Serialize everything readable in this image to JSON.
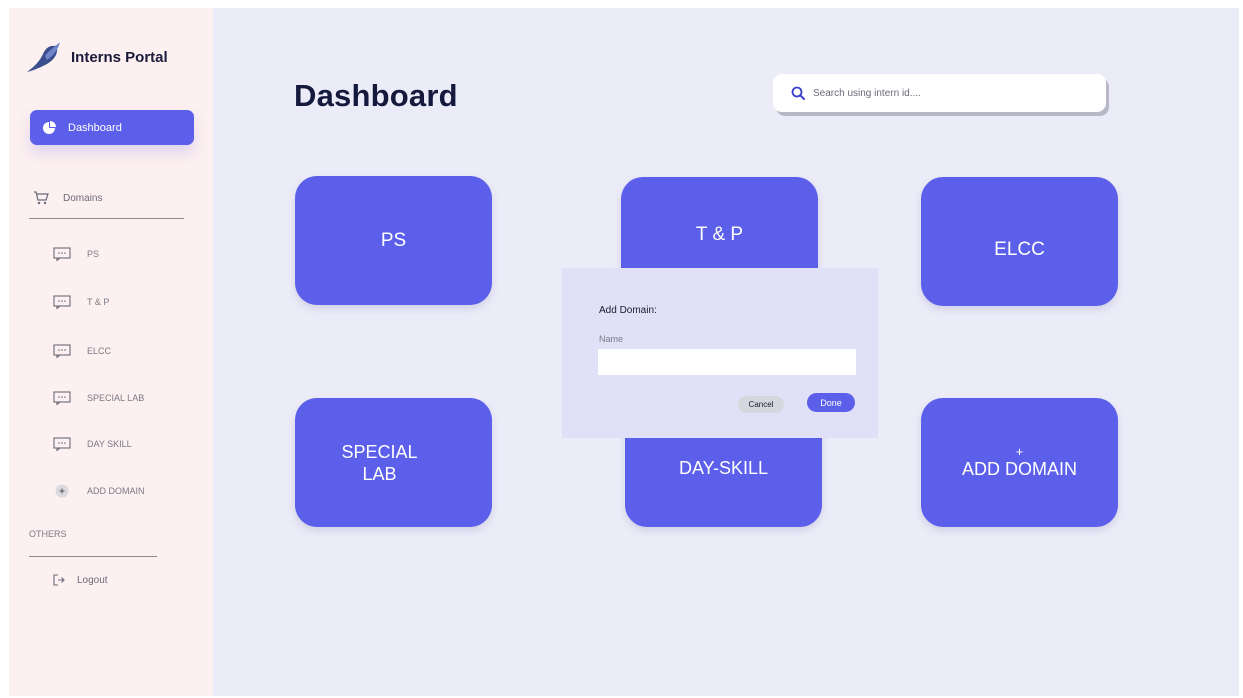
{
  "app": {
    "name": "Interns Portal"
  },
  "sidebar": {
    "active_item": "Dashboard",
    "domains_label": "Domains",
    "items": [
      {
        "label": "PS"
      },
      {
        "label": "T & P"
      },
      {
        "label": "ELCC"
      },
      {
        "label": "SPECIAL LAB"
      },
      {
        "label": "DAY SKILL"
      }
    ],
    "add_domain_label": "ADD DOMAIN",
    "others_label": "OTHERS",
    "logout_label": "Logout"
  },
  "main": {
    "title": "Dashboard",
    "search": {
      "placeholder": "Search using intern id....",
      "value": ""
    },
    "cards": [
      {
        "label": "PS"
      },
      {
        "label": "T & P"
      },
      {
        "label": "ELCC"
      },
      {
        "label_line1": "SPECIAL",
        "label_line2": "LAB"
      },
      {
        "label": "DAY-SKILL"
      },
      {
        "plus": "+",
        "label": "ADD DOMAIN"
      }
    ]
  },
  "modal": {
    "title": "Add Domain:",
    "name_label": "Name",
    "name_value": "",
    "cancel_label": "Cancel",
    "done_label": "Done"
  },
  "colors": {
    "accent": "#5b5fe9",
    "sidebar_bg": "#fdf0f0",
    "main_bg": "#ececf8",
    "modal_bg": "#e0e0f6",
    "title": "#151a3d"
  },
  "icons": {
    "logo": "bird-logo-icon",
    "dashboard": "pie-chart-icon",
    "domains": "cart-icon",
    "domain_item": "chat-bubble-icon",
    "add_domain": "plus-circle-icon",
    "search": "search-icon",
    "logout": "logout-icon"
  }
}
